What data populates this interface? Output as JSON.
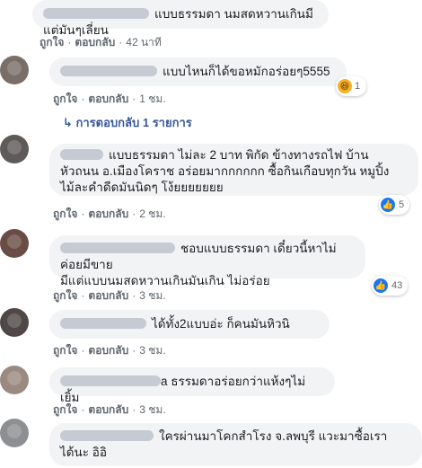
{
  "comments": [
    {
      "text": "แบบธรรมดา นมสดหวานเกินมีแต่มันๆเลี่ยน",
      "like": "ถูกใจ",
      "reply": "ตอบกลับ",
      "time": "42 นาที"
    },
    {
      "text": "แบบไหนก็ได้ขอหมักอร่อยๆ5555",
      "like": "ถูกใจ",
      "reply": "ตอบกลับ",
      "time": "1 ชม.",
      "reaction_count": "1"
    },
    {
      "text_lines": [
        "แบบธรรมดา ไม่ละ 2 บาท พิกัด ข้างทางรถไฟ บ้าน",
        "หัวถนน อ.เมืองโคราช อร่อยมากกกกกก ซื้อกินเกือบทุกวัน หมูปิ้ง",
        "ไม้ละคำดีดมันนิดๆ โง้ยยยยยยย"
      ],
      "like": "ถูกใจ",
      "reply": "ตอบกลับ",
      "time": "2 ชม.",
      "reaction_count": "5"
    },
    {
      "text_lines": [
        "ชอบแบบธรรมดา เดี๋ยวนี้หาไม่ค่อยมีขาย",
        "มีแต่แบบนมสดหวานเกินมันเกิน ไม่อร่อย"
      ],
      "like": "ถูกใจ",
      "reply": "ตอบกลับ",
      "time": "3 ชม.",
      "reaction_count": "43"
    },
    {
      "text": "ได้ทั้ง2แบบอ่ะ ก็คนมันหิวนิ",
      "like": "ถูกใจ",
      "reply": "ตอบกลับ",
      "time": "3 ชม."
    },
    {
      "text": "a ธรรมดาอร่อยกว่าแห้งๆไม่เยิ้ม",
      "like": "ถูกใจ",
      "reply": "ตอบกลับ",
      "time": "3 ชม."
    },
    {
      "text_lines": [
        "ใครผ่านมาโคกสำโรง จ.ลพบุรี แวะมาซื้อเรา",
        "ได้นะ อิอิ"
      ]
    }
  ],
  "replies_link": "↳ การตอบกลับ 1 รายการ",
  "colors": {
    "like_blue": "#1877f2",
    "link": "#385898",
    "bubble": "#f2f3f5"
  },
  "icons": {
    "like": "thumbs-up-icon",
    "haha": "haha-emoji-icon"
  }
}
